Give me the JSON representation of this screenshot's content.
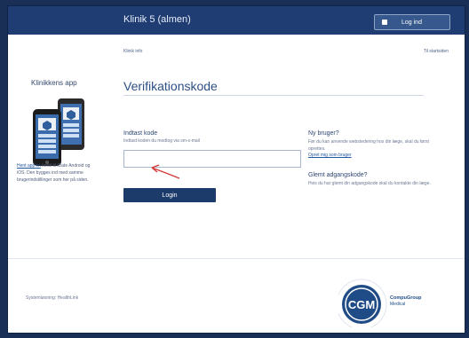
{
  "header": {
    "app_title": "Klinik 5 (almen)",
    "logout_label": "Log ind"
  },
  "subnav": {
    "left": "Klinik info",
    "right": "Til startsiden"
  },
  "sidebar": {
    "title": "Klinikkens app",
    "link_text": "Hent app'en",
    "text": " hertil til iDate Android og iOS. Den bygges ind med samme brugerindstillinger som her på siden."
  },
  "main": {
    "page_title": "Verifikationskode",
    "form_title": "Indtast kode",
    "form_hint": "Indtast koden du modtog via sm-s-mail",
    "code_value": "",
    "login_label": "Login"
  },
  "right": {
    "new_user_title": "Ny bruger?",
    "new_user_text": "Før du kan anvende webstedering hos din læge, skal du først oprettes.",
    "new_user_link": "Opret mig som bruger",
    "forgot_title": "Glemt adgangskode?",
    "forgot_text": "Hvis du har glemt din adgangskode skal du kontakte din læge."
  },
  "footer": {
    "text": "Systemløsning: HealthLink"
  },
  "logo": {
    "mark": "CGM",
    "name_line1": "CompuGroup",
    "name_line2": "Medical"
  },
  "colors": {
    "page_border": "#1a2f56",
    "header_bg": "#1f3d73",
    "primary_button": "#1c3a6a",
    "link": "#2457a2",
    "annotation_arrow": "#d43b3b"
  }
}
